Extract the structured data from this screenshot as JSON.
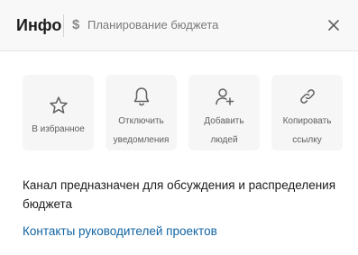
{
  "header": {
    "title": "Инфо",
    "channel_symbol": "$",
    "channel_name": "Планирование бюджета"
  },
  "actions": [
    {
      "icon": "star-icon",
      "label": "В избранное"
    },
    {
      "icon": "bell-icon",
      "label": "Отключить\nуведомления"
    },
    {
      "icon": "add-user-icon",
      "label": "Добавить\nлюдей"
    },
    {
      "icon": "link-icon",
      "label": "Копировать\nссылку"
    }
  ],
  "description": "Канал предназначен для обсуждения и распределения бюджета",
  "link_text": "Контакты руководителей проектов",
  "colors": {
    "header_bg": "#f8f8f8",
    "tile_bg": "#f6f6f6",
    "icon": "#616061",
    "link": "#1264a3",
    "text": "#1d1c1d"
  }
}
